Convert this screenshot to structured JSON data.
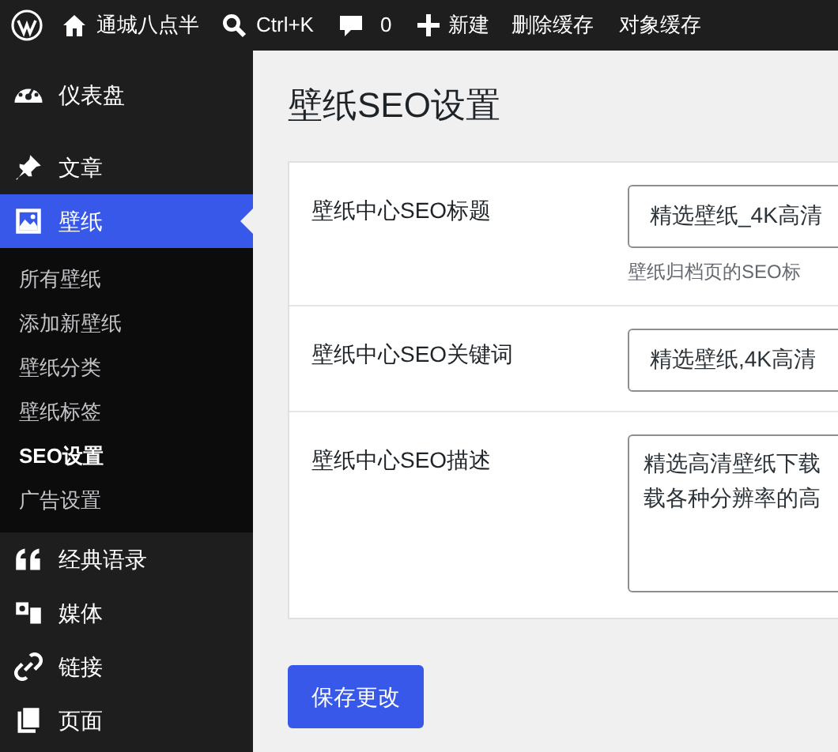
{
  "admin_bar": {
    "site": "通城八点半",
    "search": "Ctrl+K",
    "comments": "0",
    "new": "新建",
    "links": [
      "删除缓存",
      "对象缓存"
    ]
  },
  "sidebar": {
    "items": [
      {
        "label": "仪表盘",
        "selected": false
      },
      {
        "label": "文章",
        "selected": false
      },
      {
        "label": "壁纸",
        "selected": true,
        "children": [
          {
            "label": "所有壁纸",
            "selected": false
          },
          {
            "label": "添加新壁纸",
            "selected": false
          },
          {
            "label": "壁纸分类",
            "selected": false
          },
          {
            "label": "壁纸标签",
            "selected": false
          },
          {
            "label": "SEO设置",
            "selected": true
          },
          {
            "label": "广告设置",
            "selected": false
          }
        ]
      },
      {
        "label": "经典语录",
        "selected": false
      },
      {
        "label": "媒体",
        "selected": false
      },
      {
        "label": "链接",
        "selected": false
      },
      {
        "label": "页面",
        "selected": false
      }
    ]
  },
  "page": {
    "title": "壁纸SEO设置",
    "fields": [
      {
        "kind": "input",
        "label": "壁纸中心SEO标题",
        "value": "精选壁纸_4K高清",
        "hint": "壁纸归档页的SEO标"
      },
      {
        "kind": "input",
        "label": "壁纸中心SEO关键词",
        "value": "精选壁纸,4K高清"
      },
      {
        "kind": "textarea",
        "label": "壁纸中心SEO描述",
        "lines": [
          "精选高清壁纸下载",
          "载各种分辨率的高"
        ]
      }
    ],
    "save_button": "保存更改"
  }
}
